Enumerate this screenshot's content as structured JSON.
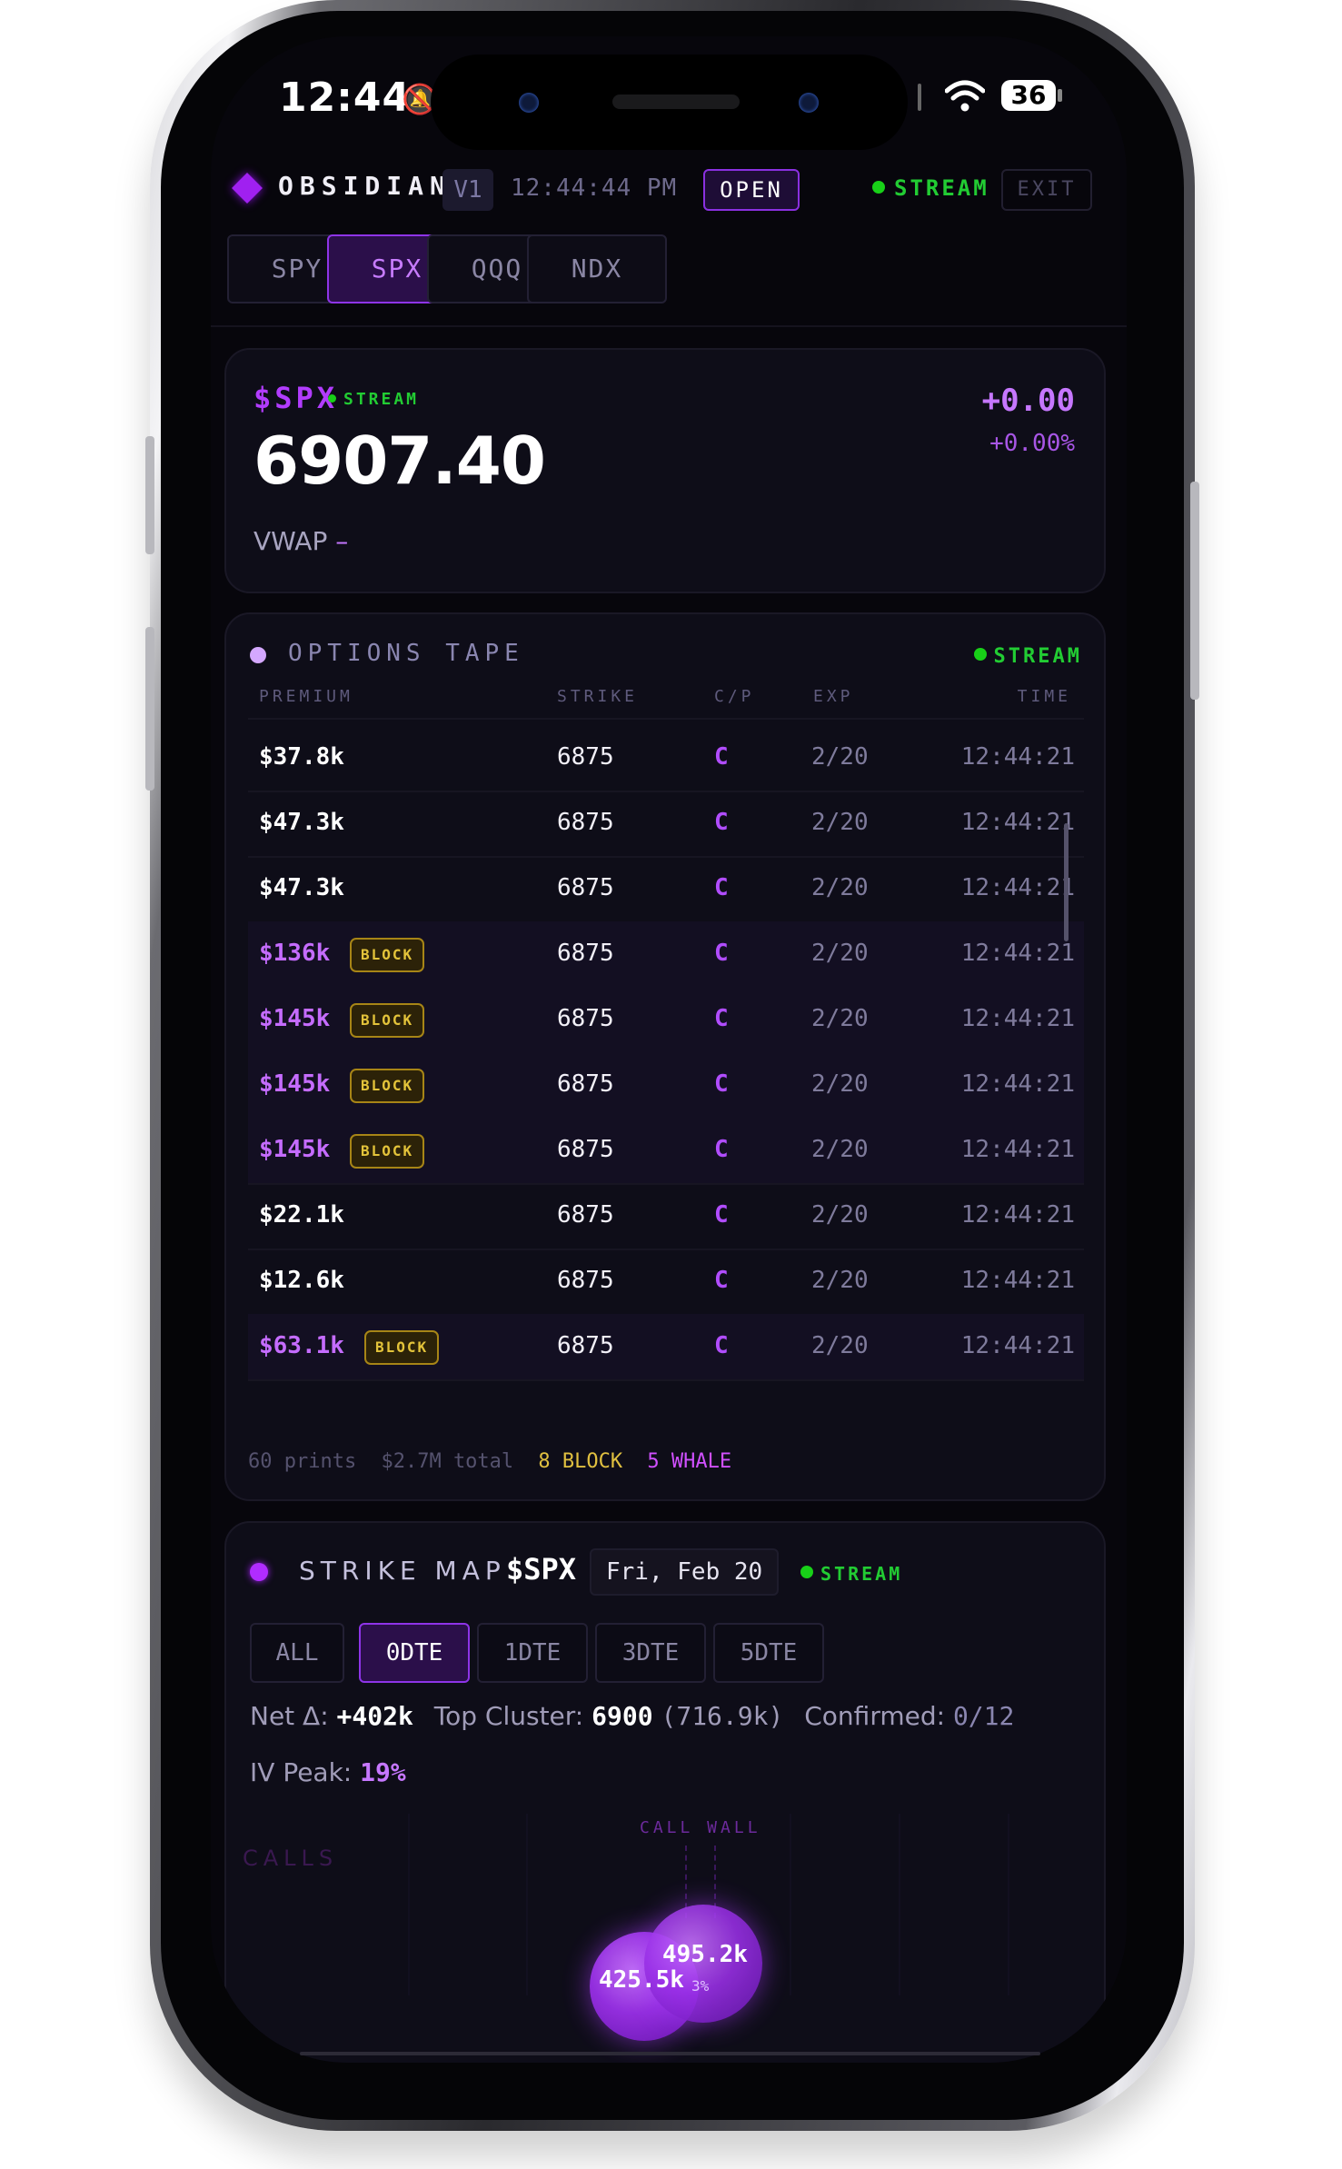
{
  "status_bar": {
    "time": "12:44",
    "battery": "36"
  },
  "header": {
    "brand": "OBSIDIAN",
    "version": "V1",
    "clock": "12:44:44 PM",
    "market_state": "OPEN",
    "stream_label": "STREAM",
    "exit_label": "EXIT",
    "tabs": [
      {
        "label": "SPY",
        "active": false
      },
      {
        "label": "SPX",
        "active": true
      },
      {
        "label": "QQQ",
        "active": false
      },
      {
        "label": "NDX",
        "active": false
      }
    ]
  },
  "quote": {
    "ticker": "$SPX",
    "stream_label": "STREAM",
    "price": "6907.40",
    "change": "+0.00",
    "change_pct": "+0.00%",
    "vwap_label": "VWAP",
    "vwap_value": "–"
  },
  "tape": {
    "title": "OPTIONS TAPE",
    "stream_label": "STREAM",
    "columns": [
      "PREMIUM",
      "STRIKE",
      "C/P",
      "EXP",
      "TIME"
    ],
    "rows": [
      {
        "premium": "$37.8k",
        "block": false,
        "strike": "6875",
        "cp": "C",
        "exp": "2/20",
        "time": "12:44:21"
      },
      {
        "premium": "$47.3k",
        "block": false,
        "strike": "6875",
        "cp": "C",
        "exp": "2/20",
        "time": "12:44:21"
      },
      {
        "premium": "$47.3k",
        "block": false,
        "strike": "6875",
        "cp": "C",
        "exp": "2/20",
        "time": "12:44:21"
      },
      {
        "premium": "$136k",
        "block": true,
        "strike": "6875",
        "cp": "C",
        "exp": "2/20",
        "time": "12:44:21"
      },
      {
        "premium": "$145k",
        "block": true,
        "strike": "6875",
        "cp": "C",
        "exp": "2/20",
        "time": "12:44:21"
      },
      {
        "premium": "$145k",
        "block": true,
        "strike": "6875",
        "cp": "C",
        "exp": "2/20",
        "time": "12:44:21"
      },
      {
        "premium": "$145k",
        "block": true,
        "strike": "6875",
        "cp": "C",
        "exp": "2/20",
        "time": "12:44:21"
      },
      {
        "premium": "$22.1k",
        "block": false,
        "strike": "6875",
        "cp": "C",
        "exp": "2/20",
        "time": "12:44:21"
      },
      {
        "premium": "$12.6k",
        "block": false,
        "strike": "6875",
        "cp": "C",
        "exp": "2/20",
        "time": "12:44:21"
      },
      {
        "premium": "$63.1k",
        "block": true,
        "strike": "6875",
        "cp": "C",
        "exp": "2/20",
        "time": "12:44:21"
      }
    ],
    "block_badge": "BLOCK",
    "footer": {
      "prints": "60 prints",
      "total": "$2.7M total",
      "block": "8 BLOCK",
      "whale": "5 WHALE"
    }
  },
  "strike_map": {
    "title": "STRIKE MAP",
    "ticker": "$SPX",
    "date": "Fri, Feb 20",
    "stream_label": "STREAM",
    "dte_filters": [
      {
        "label": "ALL",
        "active": false
      },
      {
        "label": "0DTE",
        "active": true
      },
      {
        "label": "1DTE",
        "active": false
      },
      {
        "label": "3DTE",
        "active": false
      },
      {
        "label": "5DTE",
        "active": false
      }
    ],
    "stats": {
      "net_delta_label": "Net Δ:",
      "net_delta": "+402k",
      "top_cluster_label": "Top Cluster:",
      "top_cluster": "6900",
      "top_cluster_size": "(716.9k)",
      "confirmed_label": "Confirmed:",
      "confirmed": "0/12",
      "iv_peak_label": "IV Peak:",
      "iv_peak": "19%"
    },
    "call_wall_label": "CALL WALL",
    "calls_label": "CALLS",
    "bubbles": [
      {
        "label": "425.5k"
      },
      {
        "label": "495.2k",
        "sub": "3%"
      }
    ]
  },
  "colors": {
    "accent": "#b23cff",
    "stream": "#22cc33",
    "block": "#e3c33a",
    "bg": "#07060c"
  }
}
